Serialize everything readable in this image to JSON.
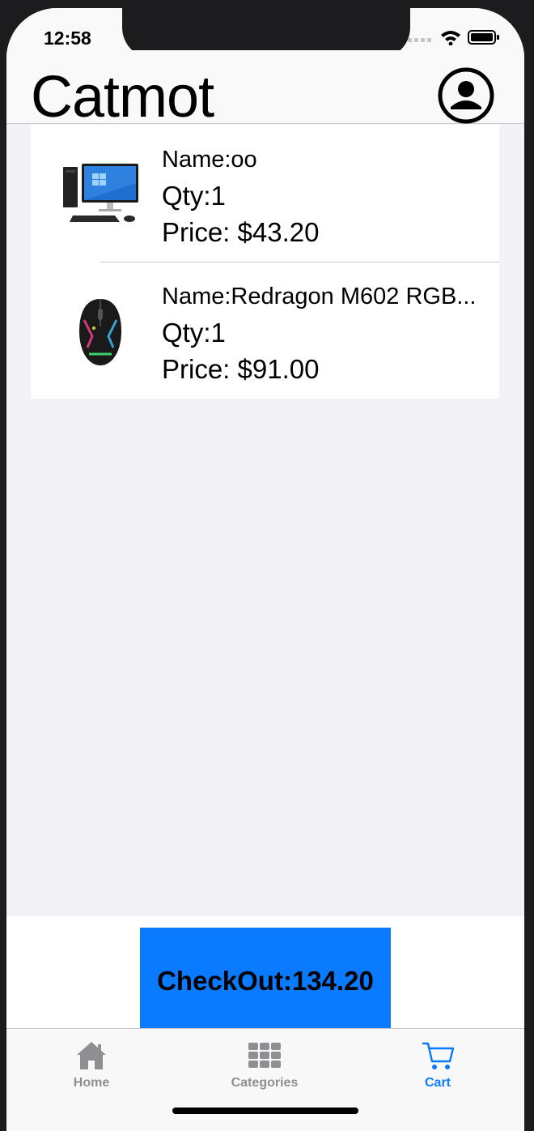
{
  "status": {
    "time": "12:58"
  },
  "header": {
    "title": "Catmot"
  },
  "cart": {
    "items": [
      {
        "name": "Name:oo",
        "qty": "Qty:1",
        "price": "Price: $43.20",
        "image": "desktop-computer-image"
      },
      {
        "name": "Name:Redragon M602 RGB...",
        "qty": "Qty:1",
        "price": "Price: $91.00",
        "image": "gaming-mouse-image"
      }
    ]
  },
  "checkout": {
    "label": "CheckOut:134.20"
  },
  "tabs": [
    {
      "label": "Home",
      "icon": "home-icon",
      "active": false
    },
    {
      "label": "Categories",
      "icon": "grid-icon",
      "active": false
    },
    {
      "label": "Cart",
      "icon": "cart-icon",
      "active": true
    }
  ],
  "colors": {
    "accent": "#0a7aff",
    "inactive": "#8e8e93",
    "background": "#f2f2f7"
  }
}
